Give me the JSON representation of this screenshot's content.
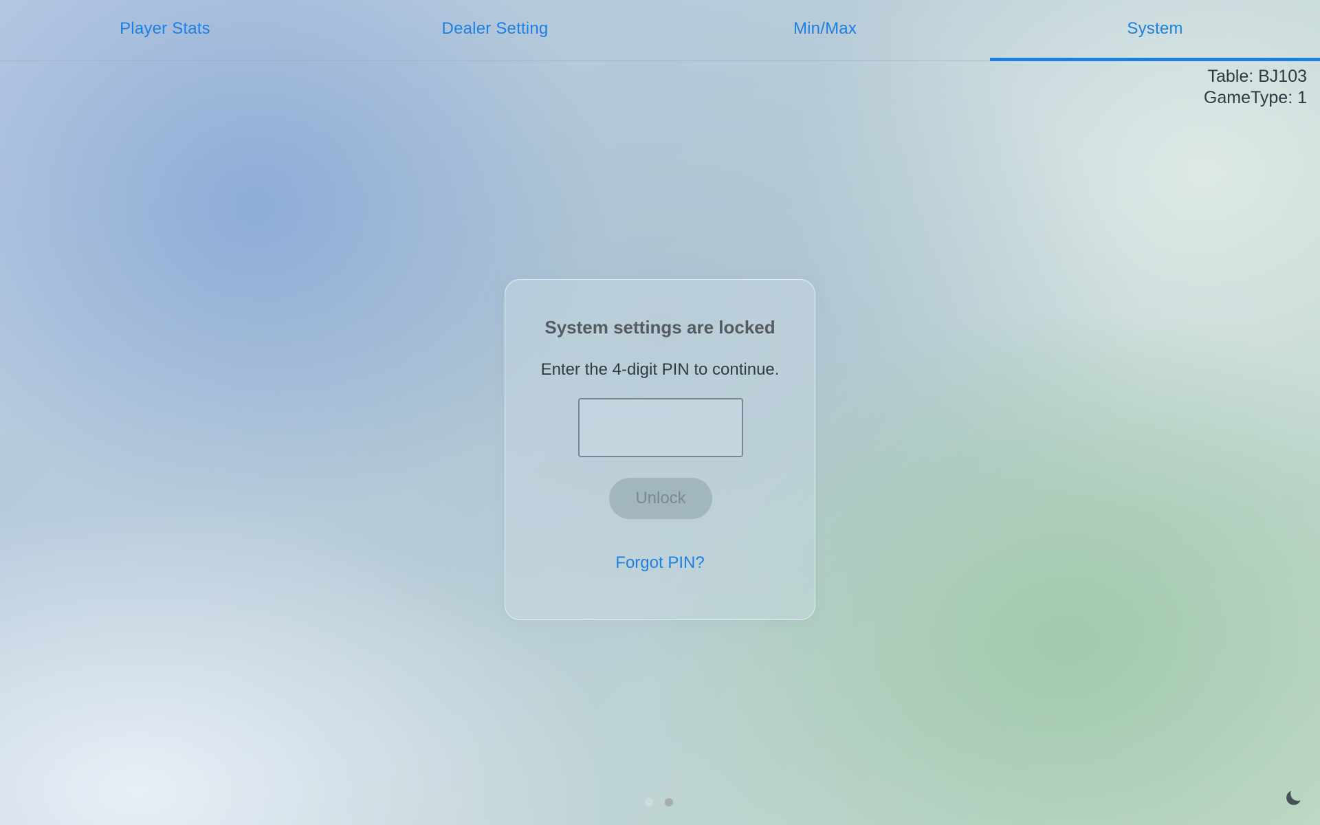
{
  "tabs": [
    {
      "label": "Player Stats",
      "active": false
    },
    {
      "label": "Dealer Setting",
      "active": false
    },
    {
      "label": "Min/Max",
      "active": false
    },
    {
      "label": "System",
      "active": true
    }
  ],
  "table_info": {
    "table": "Table: BJ103",
    "game_type": "GameType: 1"
  },
  "lock_dialog": {
    "title": "System settings are locked",
    "subtitle": "Enter the 4-digit PIN to continue.",
    "pin_value": "",
    "unlock_label": "Unlock",
    "forgot_label": "Forgot PIN?"
  },
  "pager": {
    "count": 2,
    "active_index": 1
  },
  "theme_toggle": {
    "icon": "moon-icon"
  },
  "colors": {
    "accent": "#1f7fe0",
    "text_dark": "#333b42",
    "title_gray": "#565b60",
    "button_disabled_bg": "#a3b3bc",
    "button_disabled_text": "#7a8892"
  }
}
